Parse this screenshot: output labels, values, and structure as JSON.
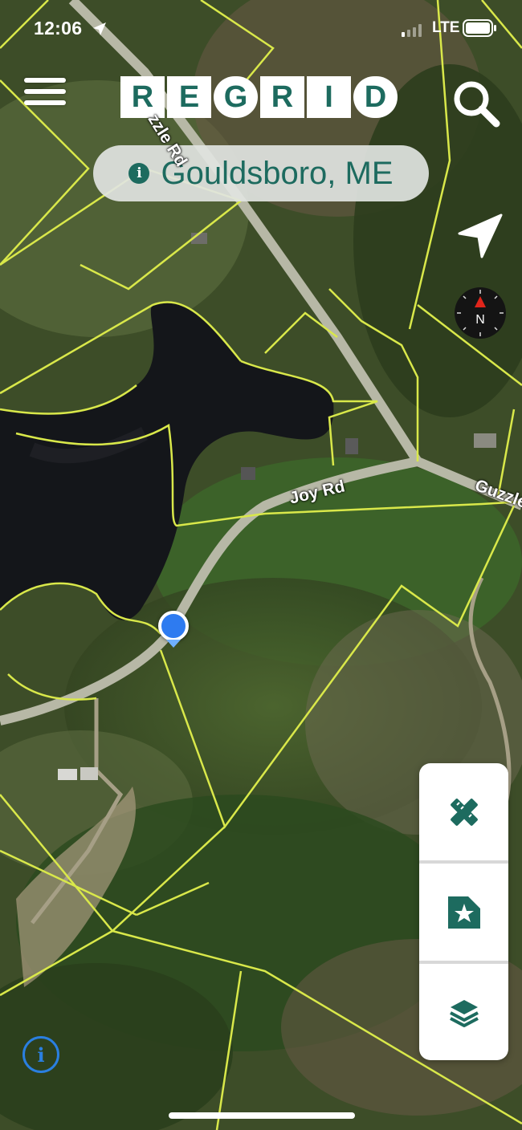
{
  "status_bar": {
    "time": "12:06",
    "network": "LTE"
  },
  "app": {
    "logo_letters": [
      "R",
      "E",
      "G",
      "R",
      "I",
      "D"
    ],
    "location": "Gouldsboro, ME",
    "info_glyph": "i",
    "compass_label": "N"
  },
  "map": {
    "roads": {
      "joy": "Joy Rd",
      "guzzle_upper": "zzle Rd",
      "guzzle_right": "Guzzle"
    }
  },
  "tools": [
    {
      "name": "draw-tools",
      "icon": "pencil-ruler-icon"
    },
    {
      "name": "saved-places",
      "icon": "star-bookmark-icon"
    },
    {
      "name": "layers",
      "icon": "layers-icon"
    }
  ],
  "colors": {
    "brand": "#1d6b5f",
    "parcel_lines": "#d9e84a",
    "user_dot": "#2e7bf0",
    "info_blue": "#2a7fe0"
  },
  "icons": [
    "menu-icon",
    "search-icon",
    "navigation-arrow-icon",
    "compass-icon",
    "info-icon"
  ]
}
